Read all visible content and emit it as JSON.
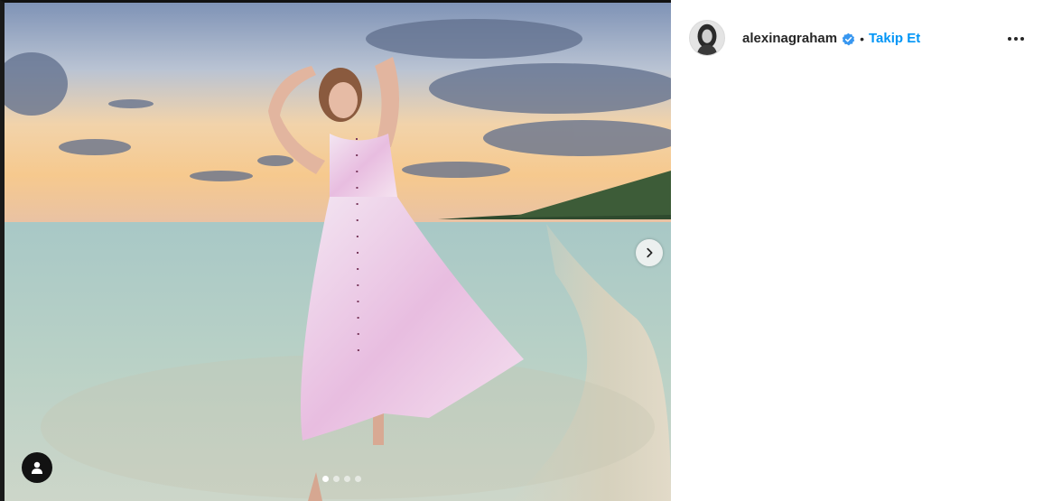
{
  "post": {
    "carousel": {
      "slide_count": 4,
      "active_index": 0
    }
  },
  "header": {
    "username": "alexinagraham",
    "separator": "•",
    "follow_label": "Takip Et"
  },
  "icons": {
    "next": "chevron-right-icon",
    "tags": "user-tag-icon",
    "verified": "verified-badge-icon",
    "more": "more-options-icon"
  },
  "colors": {
    "accent": "#0095f6",
    "text": "#262626"
  }
}
